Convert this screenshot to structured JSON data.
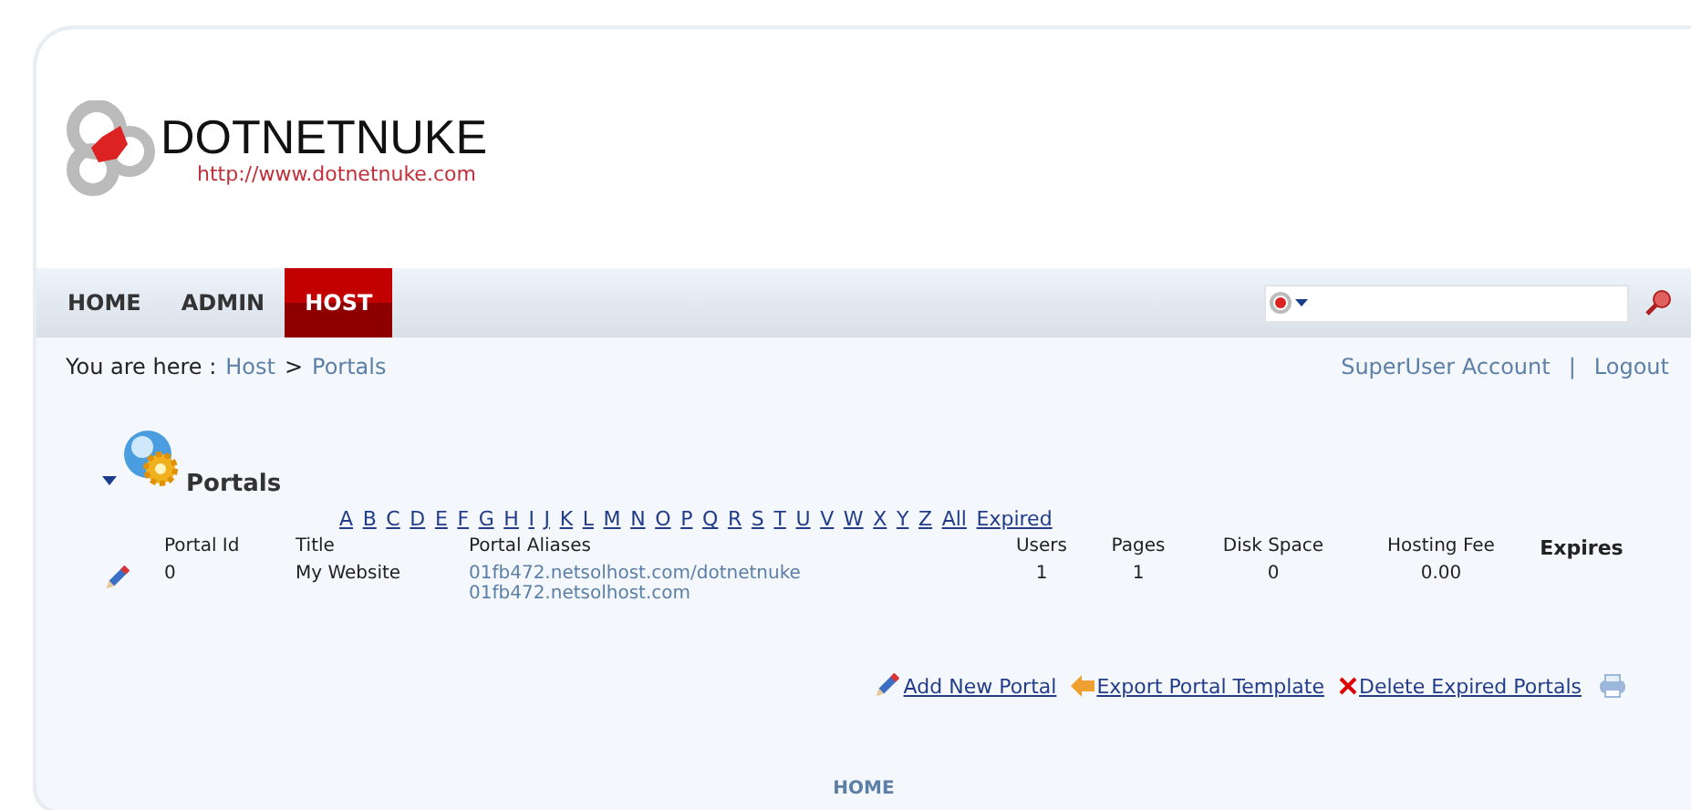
{
  "logo": {
    "name": "DOTNETNUKE",
    "url": "http://www.dotnetnuke.com"
  },
  "nav": [
    {
      "label": "HOME",
      "selected": false
    },
    {
      "label": "ADMIN",
      "selected": false
    },
    {
      "label": "HOST",
      "selected": true
    }
  ],
  "breadcrumb": {
    "prefix": "You are here :",
    "items": [
      "Host",
      "Portals"
    ],
    "separator": ">"
  },
  "user_links": {
    "account": "SuperUser Account",
    "separator": "|",
    "logout": "Logout"
  },
  "module": {
    "title": "Portals"
  },
  "filter_letters": [
    "A",
    "B",
    "C",
    "D",
    "E",
    "F",
    "G",
    "H",
    "I",
    "J",
    "K",
    "L",
    "M",
    "N",
    "O",
    "P",
    "Q",
    "R",
    "S",
    "T",
    "U",
    "V",
    "W",
    "X",
    "Y",
    "Z",
    "All",
    "Expired"
  ],
  "table": {
    "columns": [
      "Portal Id",
      "Title",
      "Portal Aliases",
      "Users",
      "Pages",
      "Disk Space",
      "Hosting Fee",
      "Expires"
    ],
    "rows": [
      {
        "portal_id": "0",
        "title": "My Website",
        "aliases": [
          "01fb472.netsolhost.com/dotnetnuke",
          "01fb472.netsolhost.com"
        ],
        "users": "1",
        "pages": "1",
        "disk_space": "0",
        "hosting_fee": "0.00"
      }
    ]
  },
  "actions": [
    {
      "kind": "add",
      "label": "Add New Portal"
    },
    {
      "kind": "export",
      "label": "Export Portal Template"
    },
    {
      "kind": "delete",
      "label": "Delete Expired Portals"
    }
  ],
  "footer": {
    "link": "HOME"
  }
}
